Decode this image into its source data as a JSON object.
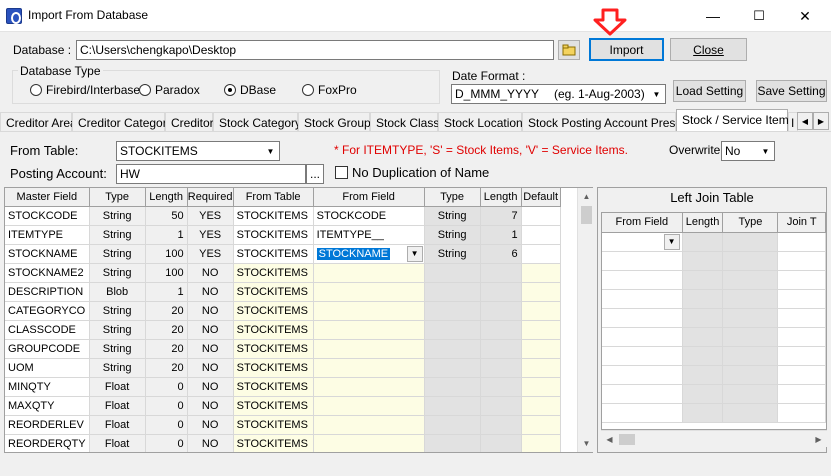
{
  "window": {
    "title": "Import From Database",
    "min_glyph": "—",
    "max_glyph": "☐",
    "close_glyph": "✕"
  },
  "database": {
    "label": "Database :",
    "path": "C:\\Users\\chengkapo\\Desktop",
    "browse_icon": "folder-browse-icon"
  },
  "buttons": {
    "import": "Import",
    "close": "Close",
    "load_setting": "Load Setting",
    "save_setting": "Save Setting"
  },
  "database_type": {
    "legend": "Database Type",
    "options": [
      {
        "label": "Firebird/Interbase",
        "selected": false
      },
      {
        "label": "Paradox",
        "selected": false
      },
      {
        "label": "DBase",
        "selected": true
      },
      {
        "label": "FoxPro",
        "selected": false
      }
    ]
  },
  "date_format": {
    "label": "Date Format :",
    "value": "D_MMM_YYYY",
    "example": "(eg. 1-Aug-2003)"
  },
  "tabs": [
    {
      "label": "Creditor Area",
      "active": false
    },
    {
      "label": "Creditor Category",
      "active": false
    },
    {
      "label": "Creditor",
      "active": false
    },
    {
      "label": "Stock Category",
      "active": false
    },
    {
      "label": "Stock Group",
      "active": false
    },
    {
      "label": "Stock Class",
      "active": false
    },
    {
      "label": "Stock Location",
      "active": false
    },
    {
      "label": "Stock Posting Account Preset",
      "active": false
    },
    {
      "label": "Stock / Service Item",
      "active": true
    },
    {
      "label": "I",
      "active": false
    }
  ],
  "from_table": {
    "label": "From Table:",
    "value": "STOCKITEMS"
  },
  "posting_account": {
    "label": "Posting Account:",
    "value": "HW",
    "ellipsis": "..."
  },
  "note": "* For ITEMTYPE, 'S' = Stock Items, 'V' = Service Items.",
  "overwrite": {
    "label": "Overwrite",
    "value": "No"
  },
  "no_duplication": {
    "label": "No Duplication of Name",
    "checked": false
  },
  "grid": {
    "headers": [
      "Master Field",
      "Type",
      "Length",
      "Required",
      "From Table",
      "From Field",
      "Type",
      "Length",
      "Default"
    ],
    "rows": [
      {
        "master": "STOCKCODE",
        "type": "String",
        "length": "50",
        "required": "YES",
        "from_table": "STOCKITEMS",
        "from_field": "STOCKCODE",
        "ftype": "String",
        "flength": "7",
        "default": ""
      },
      {
        "master": "ITEMTYPE",
        "type": "String",
        "length": "1",
        "required": "YES",
        "from_table": "STOCKITEMS",
        "from_field": "ITEMTYPE__",
        "ftype": "String",
        "flength": "1",
        "default": ""
      },
      {
        "master": "STOCKNAME",
        "type": "String",
        "length": "100",
        "required": "YES",
        "from_table": "STOCKITEMS",
        "from_field": "STOCKNAME",
        "ftype": "String",
        "flength": "6",
        "default": ""
      },
      {
        "master": "STOCKNAME2",
        "type": "String",
        "length": "100",
        "required": "NO",
        "from_table": "STOCKITEMS",
        "from_field": "",
        "ftype": "",
        "flength": "",
        "default": ""
      },
      {
        "master": "DESCRIPTION",
        "type": "Blob",
        "length": "1",
        "required": "NO",
        "from_table": "STOCKITEMS",
        "from_field": "",
        "ftype": "",
        "flength": "",
        "default": ""
      },
      {
        "master": "CATEGORYCO",
        "type": "String",
        "length": "20",
        "required": "NO",
        "from_table": "STOCKITEMS",
        "from_field": "",
        "ftype": "",
        "flength": "",
        "default": ""
      },
      {
        "master": "CLASSCODE",
        "type": "String",
        "length": "20",
        "required": "NO",
        "from_table": "STOCKITEMS",
        "from_field": "",
        "ftype": "",
        "flength": "",
        "default": ""
      },
      {
        "master": "GROUPCODE",
        "type": "String",
        "length": "20",
        "required": "NO",
        "from_table": "STOCKITEMS",
        "from_field": "",
        "ftype": "",
        "flength": "",
        "default": ""
      },
      {
        "master": "UOM",
        "type": "String",
        "length": "20",
        "required": "NO",
        "from_table": "STOCKITEMS",
        "from_field": "",
        "ftype": "",
        "flength": "",
        "default": ""
      },
      {
        "master": "MINQTY",
        "type": "Float",
        "length": "0",
        "required": "NO",
        "from_table": "STOCKITEMS",
        "from_field": "",
        "ftype": "",
        "flength": "",
        "default": ""
      },
      {
        "master": "MAXQTY",
        "type": "Float",
        "length": "0",
        "required": "NO",
        "from_table": "STOCKITEMS",
        "from_field": "",
        "ftype": "",
        "flength": "",
        "default": ""
      },
      {
        "master": "REORDERLEV",
        "type": "Float",
        "length": "0",
        "required": "NO",
        "from_table": "STOCKITEMS",
        "from_field": "",
        "ftype": "",
        "flength": "",
        "default": ""
      },
      {
        "master": "REORDERQTY",
        "type": "Float",
        "length": "0",
        "required": "NO",
        "from_table": "STOCKITEMS",
        "from_field": "",
        "ftype": "",
        "flength": "",
        "default": ""
      }
    ],
    "editing_row": 2
  },
  "left_join": {
    "title": "Left Join Table",
    "headers": [
      "From Field",
      "Length",
      "Type",
      "Join T"
    ]
  },
  "colors": {
    "accent": "#0078d7",
    "note_red": "#e00000",
    "arrow_red": "#ff2020",
    "cell_yellow": "#fdfde4"
  }
}
